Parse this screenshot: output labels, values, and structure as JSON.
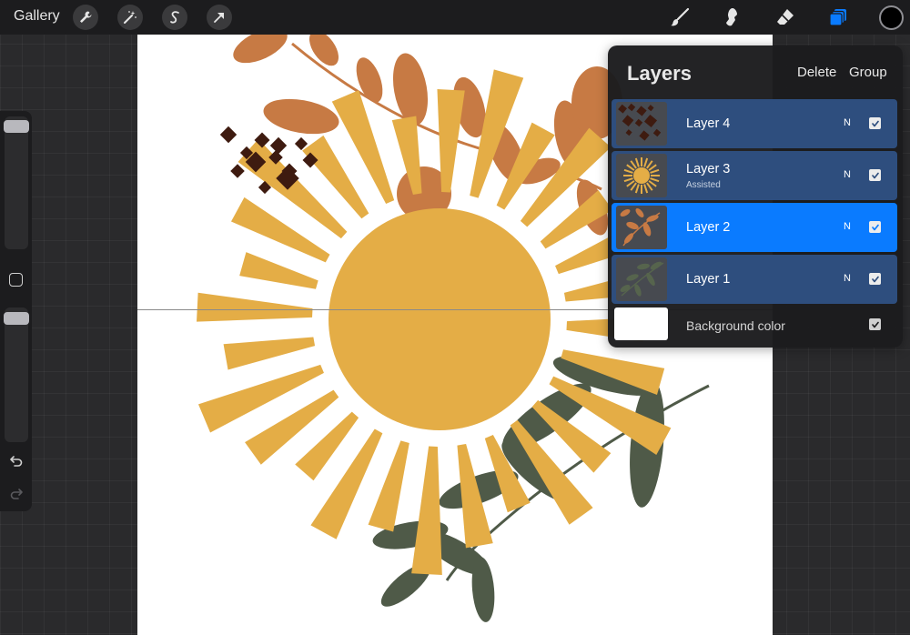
{
  "app": {
    "gallery_label": "Gallery"
  },
  "toolbar": {
    "left_tools": [
      "wrench-icon",
      "magic-wand-icon",
      "selection-icon",
      "transform-arrow-icon"
    ],
    "right_tools": [
      "brush-icon",
      "smudge-icon",
      "eraser-icon",
      "layers-icon"
    ],
    "color": "#000000",
    "active_tool_color": "#0a7bff"
  },
  "layers_panel": {
    "title": "Layers",
    "delete_label": "Delete",
    "group_label": "Group",
    "layers": [
      {
        "name": "Layer 4",
        "blend": "N",
        "visible": true,
        "subtitle": ""
      },
      {
        "name": "Layer 3",
        "blend": "N",
        "visible": true,
        "subtitle": "Assisted"
      },
      {
        "name": "Layer 2",
        "blend": "N",
        "visible": true,
        "subtitle": "",
        "selected": true
      },
      {
        "name": "Layer 1",
        "blend": "N",
        "visible": true,
        "subtitle": ""
      }
    ],
    "background": {
      "label": "Background color",
      "color": "#ffffff",
      "visible": true
    }
  },
  "colors": {
    "sun": "#e4ad46",
    "leaf_orange": "#c77a44",
    "leaf_green": "#4f5a48",
    "confetti": "#3e1b10"
  }
}
